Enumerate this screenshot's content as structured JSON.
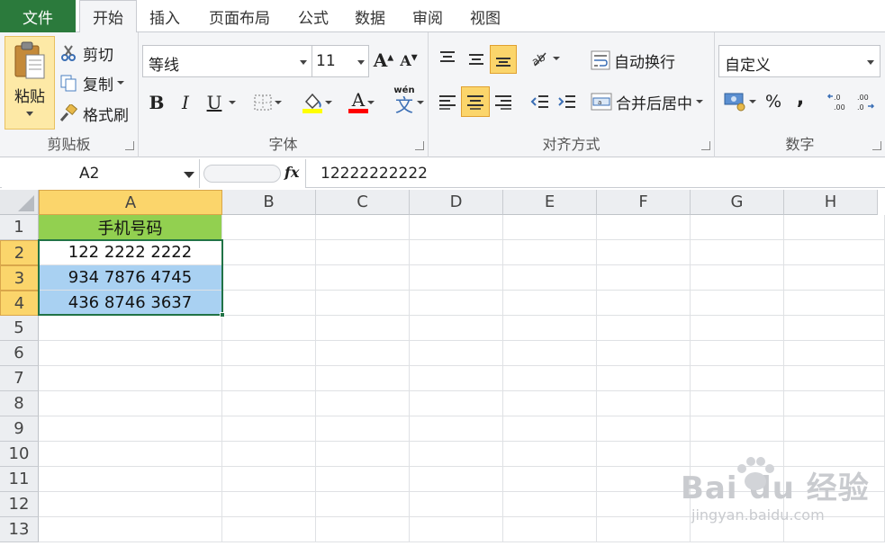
{
  "tabs": {
    "file": "文件",
    "items": [
      "开始",
      "插入",
      "页面布局",
      "公式",
      "数据",
      "审阅",
      "视图"
    ],
    "active": "开始"
  },
  "clipboard": {
    "paste": "粘贴",
    "cut": "剪切",
    "copy": "复制",
    "format_painter": "格式刷",
    "label": "剪贴板"
  },
  "font": {
    "name": "等线",
    "size": "11",
    "bold": "B",
    "italic": "I",
    "underline": "U",
    "font_color_glyph": "A",
    "phonetic_glyph": "wén",
    "label": "字体"
  },
  "alignment": {
    "wrap_text": "自动换行",
    "merge_center": "合并后居中",
    "label": "对齐方式"
  },
  "number": {
    "format": "自定义",
    "percent": "%",
    "comma": ",",
    "increase_decimal": "←.0 .00",
    "decrease_decimal": ".00 →.0",
    "label": "数字"
  },
  "formula_bar": {
    "name_box": "A2",
    "fx": "fx",
    "value": "12222222222"
  },
  "sheet": {
    "columns": [
      "A",
      "B",
      "C",
      "D",
      "E",
      "F",
      "G",
      "H"
    ],
    "rows": [
      "1",
      "2",
      "3",
      "4",
      "5",
      "6",
      "7",
      "8",
      "9",
      "10",
      "11",
      "12",
      "13"
    ],
    "cells": {
      "A1": "手机号码",
      "A2": "122 2222 2222",
      "A3": "934 7876 4745",
      "A4": "436 8746 3637"
    },
    "colors": {
      "header_fill": "#92d050",
      "selection_fill": "#a9d1f2",
      "highlight": "#fbd56b"
    }
  },
  "watermark": {
    "brand": "Bai du 经验",
    "url": "jingyan.baidu.com"
  }
}
